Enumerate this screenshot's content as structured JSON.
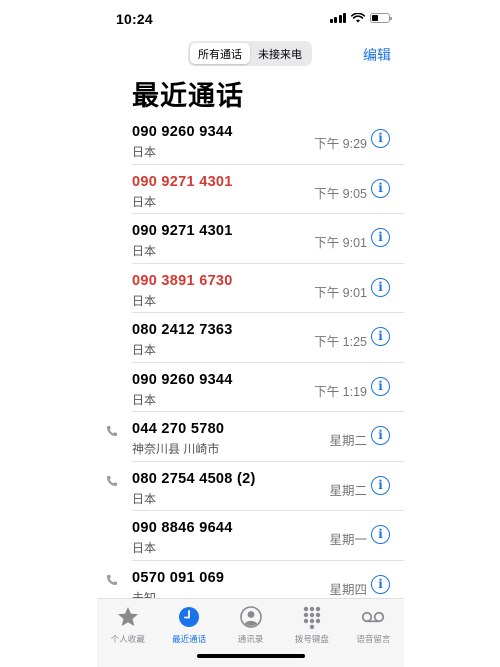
{
  "status_bar": {
    "time": "10:24"
  },
  "nav": {
    "segments": [
      "所有通话",
      "未接来电"
    ],
    "active_segment": 0,
    "edit_label": "编辑"
  },
  "title": "最近通话",
  "calls": [
    {
      "number": "090 9260 9344",
      "location": "日本",
      "time": "下午 9:29",
      "missed": false,
      "outgoing": false
    },
    {
      "number": "090 9271 4301",
      "location": "日本",
      "time": "下午 9:05",
      "missed": true,
      "outgoing": false
    },
    {
      "number": "090 9271 4301",
      "location": "日本",
      "time": "下午 9:01",
      "missed": false,
      "outgoing": false
    },
    {
      "number": "090 3891 6730",
      "location": "日本",
      "time": "下午 9:01",
      "missed": true,
      "outgoing": false
    },
    {
      "number": "080 2412 7363",
      "location": "日本",
      "time": "下午 1:25",
      "missed": false,
      "outgoing": false
    },
    {
      "number": "090 9260 9344",
      "location": "日本",
      "time": "下午 1:19",
      "missed": false,
      "outgoing": false
    },
    {
      "number": "044 270 5780",
      "location": "神奈川县 川崎市",
      "time": "星期二",
      "missed": false,
      "outgoing": true
    },
    {
      "number": "080 2754 4508 (2)",
      "location": "日本",
      "time": "星期二",
      "missed": false,
      "outgoing": true
    },
    {
      "number": "090 8846 9644",
      "location": "日本",
      "time": "星期一",
      "missed": false,
      "outgoing": false
    },
    {
      "number": "0570 091 069",
      "location": "未知",
      "time": "星期四",
      "missed": false,
      "outgoing": true
    }
  ],
  "tabs": [
    {
      "label": "个人收藏",
      "icon": "star-icon"
    },
    {
      "label": "最近通话",
      "icon": "clock-icon"
    },
    {
      "label": "通讯录",
      "icon": "contacts-icon"
    },
    {
      "label": "拨号键盘",
      "icon": "keypad-icon"
    },
    {
      "label": "语音留言",
      "icon": "voicemail-icon"
    }
  ],
  "active_tab": 1,
  "colors": {
    "accent": "#1a73e8",
    "missed": "#d33a32"
  }
}
